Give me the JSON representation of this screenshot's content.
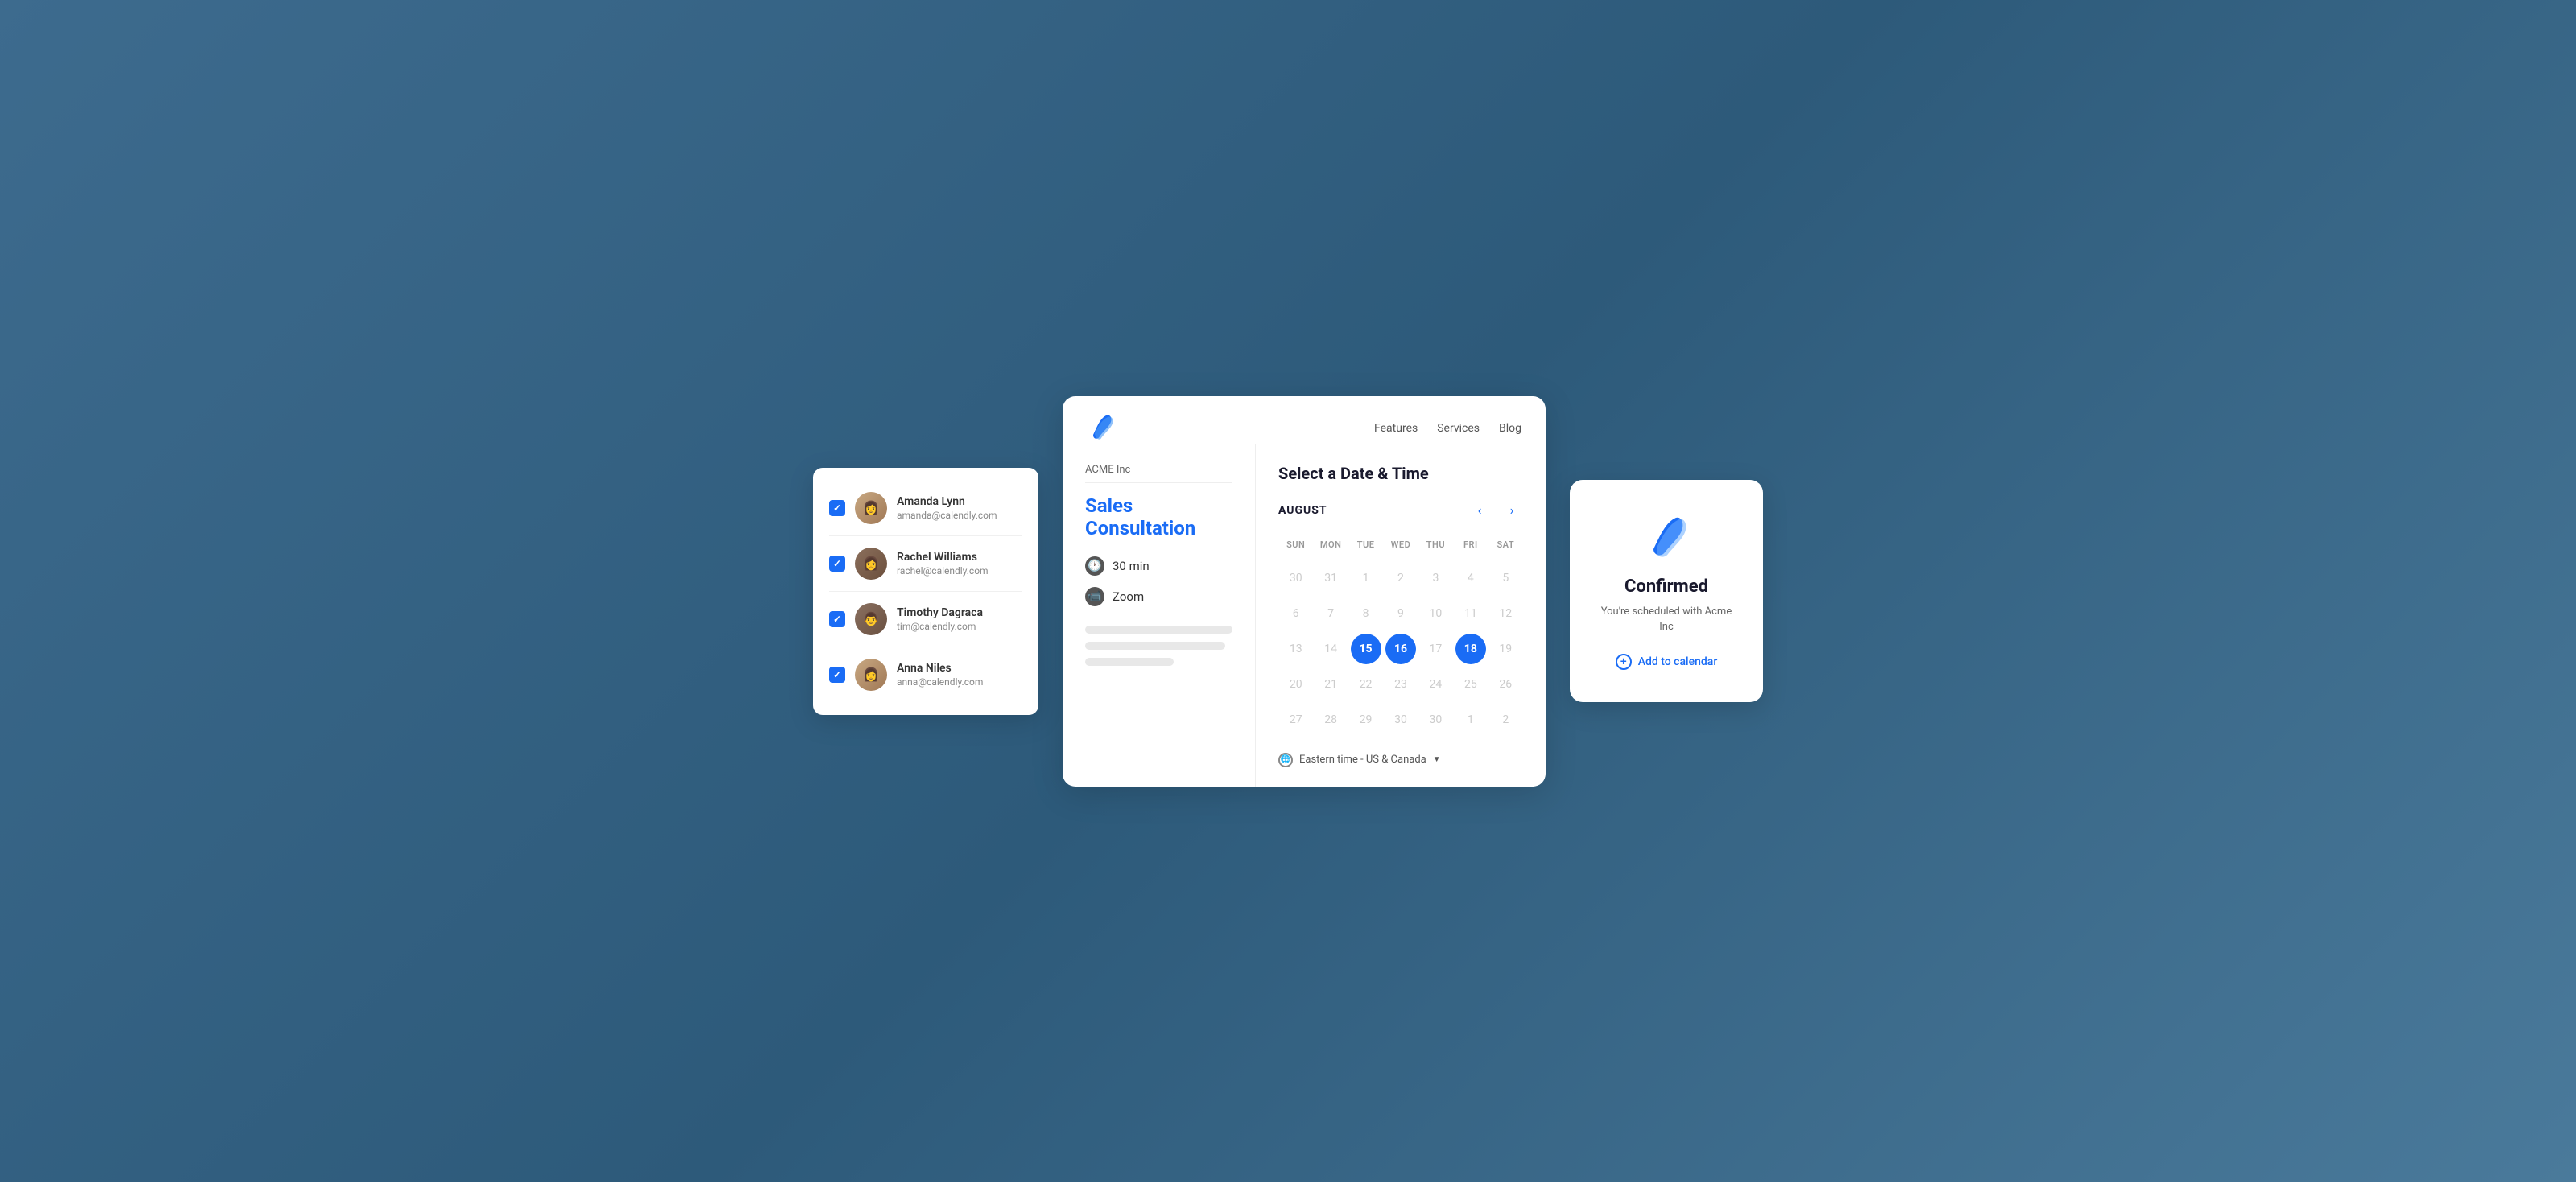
{
  "scene": {
    "background_color": "#4a7a9b"
  },
  "user_list": {
    "users": [
      {
        "id": "amanda",
        "name": "Amanda Lynn",
        "email": "amanda@calendly.com",
        "checked": true
      },
      {
        "id": "rachel",
        "name": "Rachel Williams",
        "email": "rachel@calendly.com",
        "checked": true
      },
      {
        "id": "timothy",
        "name": "Timothy Dagraca",
        "email": "tim@calendly.com",
        "checked": true
      },
      {
        "id": "anna",
        "name": "Anna Niles",
        "email": "anna@calendly.com",
        "checked": true
      }
    ]
  },
  "booking": {
    "nav": {
      "features": "Features",
      "services": "Services",
      "blog": "Blog"
    },
    "company": "ACME Inc",
    "event_title": "Sales Consultation",
    "duration": "30 min",
    "meeting_type": "Zoom",
    "calendar_title": "Select a Date & Time",
    "month": "AUGUST",
    "days_header": [
      "SUN",
      "MON",
      "TUE",
      "WED",
      "THU",
      "FRI",
      "SAT"
    ],
    "weeks": [
      [
        {
          "day": "30",
          "type": "other-month"
        },
        {
          "day": "31",
          "type": "other-month"
        },
        {
          "day": "1",
          "type": "disabled"
        },
        {
          "day": "2",
          "type": "disabled"
        },
        {
          "day": "3",
          "type": "disabled"
        },
        {
          "day": "4",
          "type": "disabled"
        },
        {
          "day": "5",
          "type": "disabled"
        }
      ],
      [
        {
          "day": "6",
          "type": "disabled"
        },
        {
          "day": "7",
          "type": "disabled"
        },
        {
          "day": "8",
          "type": "disabled"
        },
        {
          "day": "9",
          "type": "disabled"
        },
        {
          "day": "10",
          "type": "disabled"
        },
        {
          "day": "11",
          "type": "disabled"
        },
        {
          "day": "12",
          "type": "disabled"
        }
      ],
      [
        {
          "day": "13",
          "type": "disabled"
        },
        {
          "day": "14",
          "type": "disabled"
        },
        {
          "day": "15",
          "type": "selected"
        },
        {
          "day": "16",
          "type": "selected"
        },
        {
          "day": "17",
          "type": "disabled"
        },
        {
          "day": "18",
          "type": "selected"
        },
        {
          "day": "19",
          "type": "disabled"
        }
      ],
      [
        {
          "day": "20",
          "type": "disabled"
        },
        {
          "day": "21",
          "type": "disabled"
        },
        {
          "day": "22",
          "type": "disabled"
        },
        {
          "day": "23",
          "type": "disabled"
        },
        {
          "day": "24",
          "type": "disabled"
        },
        {
          "day": "25",
          "type": "disabled"
        },
        {
          "day": "26",
          "type": "disabled"
        }
      ],
      [
        {
          "day": "27",
          "type": "disabled"
        },
        {
          "day": "28",
          "type": "disabled"
        },
        {
          "day": "29",
          "type": "disabled"
        },
        {
          "day": "30",
          "type": "disabled"
        },
        {
          "day": "30",
          "type": "disabled"
        },
        {
          "day": "1",
          "type": "other-month"
        },
        {
          "day": "2",
          "type": "other-month"
        }
      ]
    ],
    "timezone": "Eastern time - US & Canada"
  },
  "confirmed": {
    "title": "Confirmed",
    "subtitle": "You're scheduled with Acme Inc",
    "add_calendar_label": "Add to calendar"
  }
}
